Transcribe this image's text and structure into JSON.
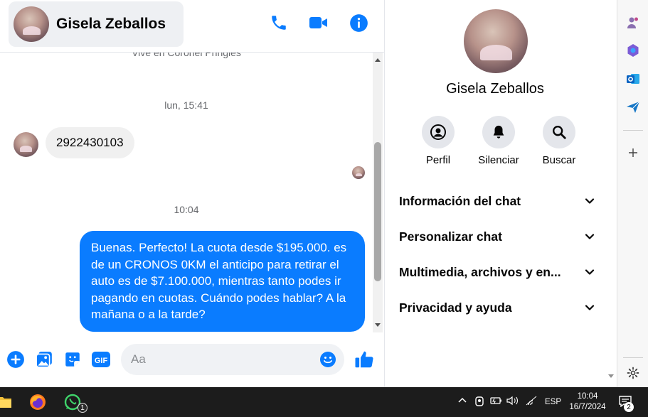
{
  "chat": {
    "contact_name": "Gisela Zeballos",
    "cut_text": "Vive en Coronel Pringles",
    "timestamp_1": "lun, 15:41",
    "incoming_message": "2922430103",
    "timestamp_2": "10:04",
    "outgoing_message": "Buenas. Perfecto! La cuota desde $195.000. es de un CRONOS 0KM el anticipo para retirar el auto es de $7.100.000, mientras tanto podes ir pagando en cuotas. Cuándo podes hablar? A la mañana o a la tarde?",
    "input_placeholder": "Aa",
    "gif_label": "GIF",
    "accent_color": "#0a7cff"
  },
  "info_panel": {
    "name": "Gisela Zeballos",
    "actions": [
      {
        "label": "Perfil",
        "icon": "profile-icon"
      },
      {
        "label": "Silenciar",
        "icon": "bell-icon"
      },
      {
        "label": "Buscar",
        "icon": "search-icon"
      }
    ],
    "sections": [
      {
        "label": "Información del chat"
      },
      {
        "label": "Personalizar chat"
      },
      {
        "label": "Multimedia, archivos y en..."
      },
      {
        "label": "Privacidad y ayuda"
      }
    ]
  },
  "taskbar": {
    "whatsapp_badge": "1",
    "language": "ESP",
    "time": "10:04",
    "date": "16/7/2024",
    "notification_count": "2"
  }
}
